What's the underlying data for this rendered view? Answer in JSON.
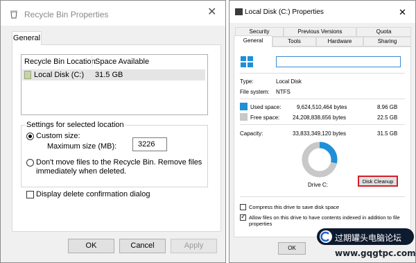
{
  "recycle_bin": {
    "title": "Recycle Bin Properties",
    "close_glyph": "✕",
    "tabs": [
      "General"
    ],
    "columns": [
      "Recycle Bin Location",
      "Space Available"
    ],
    "rows": [
      {
        "location": "Local Disk (C:)",
        "space": "31.5 GB"
      }
    ],
    "settings_group_label": "Settings for selected location",
    "custom_size_label": "Custom size:",
    "max_size_label": "Maximum size (MB):",
    "max_size_value": "3226",
    "dont_move_label": "Don't move files to the Recycle Bin. Remove files immediately when deleted.",
    "display_confirm_label": "Display delete confirmation dialog",
    "buttons": {
      "ok": "OK",
      "cancel": "Cancel",
      "apply": "Apply"
    }
  },
  "local_disk": {
    "title": "Local Disk (C:) Properties",
    "close_glyph": "✕",
    "tabs_row1": [
      "Security",
      "Previous Versions",
      "Quota"
    ],
    "tabs_row2": [
      "General",
      "Tools",
      "Hardware",
      "Sharing"
    ],
    "name_field_value": "",
    "type_label": "Type:",
    "type_value": "Local Disk",
    "fs_label": "File system:",
    "fs_value": "NTFS",
    "used_label": "Used space:",
    "used_bytes": "9,624,510,464 bytes",
    "used_gb": "8.96 GB",
    "free_label": "Free space:",
    "free_bytes": "24,208,838,656 bytes",
    "free_gb": "22.5 GB",
    "capacity_label": "Capacity:",
    "capacity_bytes": "33,833,349,120 bytes",
    "capacity_gb": "31.5 GB",
    "used_fraction": 0.284,
    "drive_label": "Drive C:",
    "disk_cleanup_label": "Disk Cleanup",
    "compress_label": "Compress this drive to save disk space",
    "index_label": "Allow files on this drive to have contents indexed in addition to file properties",
    "ok_label": "OK",
    "colors": {
      "used": "#1e90d8",
      "free": "#c8c8c8",
      "cleanup_highlight": "#d0202a"
    }
  },
  "watermark": {
    "line1": "过期罐头电脑论坛",
    "line2": "www.gqgtpc.com"
  }
}
